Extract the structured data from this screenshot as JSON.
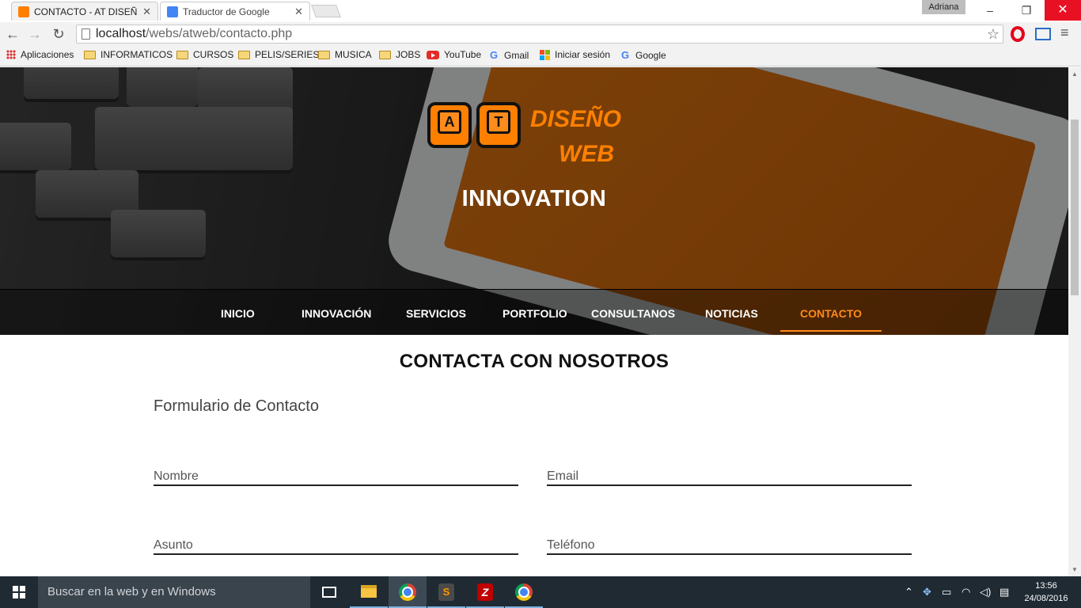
{
  "browser": {
    "tabs": [
      {
        "title": "CONTACTO - AT DISEÑO W",
        "active": true,
        "favicon_color": "#ff8000"
      },
      {
        "title": "Traductor de Google",
        "active": false,
        "favicon_color": "#4285f4"
      }
    ],
    "profile": "Adriana",
    "window_controls": {
      "minimize": "–",
      "restore": "❐",
      "close": "✕"
    },
    "tab_close": "✕",
    "url_host": "localhost",
    "url_path": "/webs/atweb/contacto.php",
    "bookmarks": [
      {
        "label": "Aplicaciones",
        "icon": "apps-grid-icon"
      },
      {
        "label": "INFORMATICOS",
        "icon": "folder-icon"
      },
      {
        "label": "CURSOS",
        "icon": "folder-icon"
      },
      {
        "label": "PELIS/SERIES",
        "icon": "folder-icon"
      },
      {
        "label": "MUSICA",
        "icon": "folder-icon"
      },
      {
        "label": "JOBS",
        "icon": "folder-icon"
      },
      {
        "label": "YouTube",
        "icon": "youtube-icon"
      },
      {
        "label": "Gmail",
        "icon": "google-icon"
      },
      {
        "label": "Iniciar sesión",
        "icon": "microsoft-icon"
      },
      {
        "label": "Google",
        "icon": "google-icon"
      }
    ]
  },
  "page": {
    "logo": {
      "letters": [
        "A",
        "T"
      ],
      "line1": "DISEÑO",
      "line2": "WEB",
      "color": "#ff8000"
    },
    "tagline": "INNOVATION",
    "nav": [
      {
        "label": "INICIO",
        "active": false
      },
      {
        "label": "INNOVACIÓN",
        "active": false
      },
      {
        "label": "SERVICIOS",
        "active": false
      },
      {
        "label": "PORTFOLIO",
        "active": false
      },
      {
        "label": "CONSULTANOS",
        "active": false
      },
      {
        "label": "NOTICIAS",
        "active": false
      },
      {
        "label": "CONTACTO",
        "active": true
      }
    ],
    "accent_color": "#ff8a1a",
    "heading": "CONTACTA CON NOSOTROS",
    "form": {
      "title": "Formulario de Contacto",
      "fields": {
        "nombre": {
          "placeholder": "Nombre",
          "value": ""
        },
        "email": {
          "placeholder": "Email",
          "value": ""
        },
        "asunto": {
          "placeholder": "Asunto",
          "value": ""
        },
        "telefono": {
          "placeholder": "Teléfono",
          "value": ""
        }
      }
    }
  },
  "taskbar": {
    "search_placeholder": "Buscar en la web y en Windows",
    "apps": [
      "task-view",
      "file-explorer",
      "chrome",
      "sublime-text",
      "filezilla",
      "chrome"
    ],
    "time": "13:56",
    "date": "24/08/2016"
  }
}
